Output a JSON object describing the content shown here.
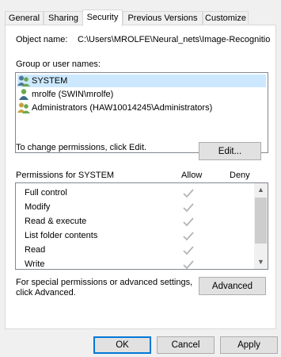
{
  "tabs": [
    {
      "label": "General"
    },
    {
      "label": "Sharing"
    },
    {
      "label": "Security"
    },
    {
      "label": "Previous Versions"
    },
    {
      "label": "Customize"
    }
  ],
  "object": {
    "label": "Object name:",
    "value": "C:\\Users\\MROLFE\\Neural_nets\\Image-Recognitio"
  },
  "groups": {
    "label": "Group or user names:",
    "items": [
      {
        "name": "SYSTEM",
        "icon": "user-group-icon"
      },
      {
        "name": "mrolfe (SWIN\\mrolfe)",
        "icon": "user-icon"
      },
      {
        "name": "Administrators (HAW10014245\\Administrators)",
        "icon": "user-group-icon"
      }
    ]
  },
  "change_text": "To change permissions, click Edit.",
  "edit_button": "Edit...",
  "permissions": {
    "header": "Permissions for SYSTEM",
    "allow_header": "Allow",
    "deny_header": "Deny",
    "rows": [
      {
        "name": "Full control",
        "allow": true,
        "deny": false
      },
      {
        "name": "Modify",
        "allow": true,
        "deny": false
      },
      {
        "name": "Read & execute",
        "allow": true,
        "deny": false
      },
      {
        "name": "List folder contents",
        "allow": true,
        "deny": false
      },
      {
        "name": "Read",
        "allow": true,
        "deny": false
      },
      {
        "name": "Write",
        "allow": true,
        "deny": false
      }
    ]
  },
  "advanced": {
    "text_line1": "For special permissions or advanced settings,",
    "text_line2": "click Advanced.",
    "button": "Advanced"
  },
  "footer": {
    "ok": "OK",
    "cancel": "Cancel",
    "apply": "Apply"
  },
  "colors": {
    "selection": "#cce8ff",
    "check_gray": "#b4b4b4"
  }
}
